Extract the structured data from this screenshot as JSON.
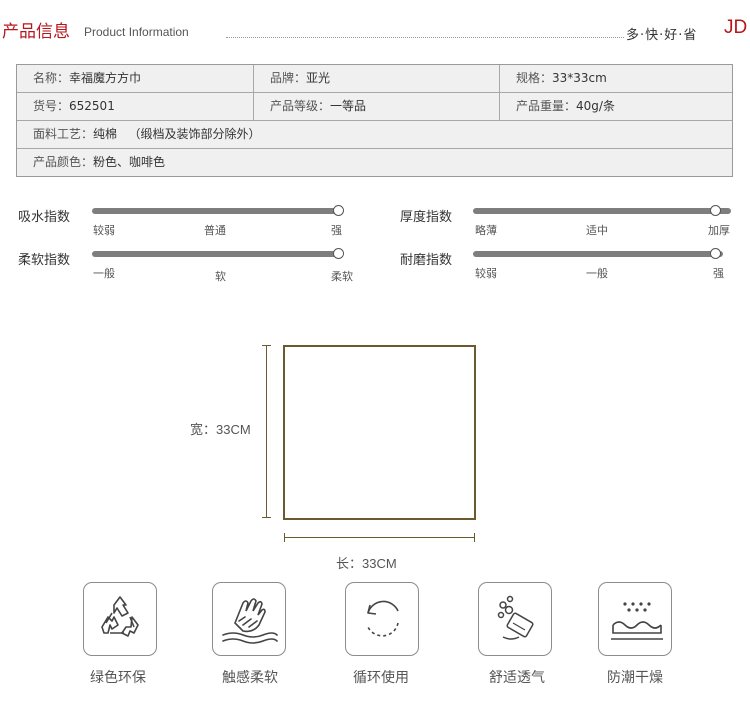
{
  "header": {
    "title": "产品信息",
    "subtitle": "Product Information",
    "slogan": "多·快·好·省",
    "logo": "JD",
    "accent": "#b8151c"
  },
  "specs": {
    "rows": [
      [
        {
          "label": "名称：",
          "value": "幸福魔方方巾"
        },
        {
          "label": "品牌：",
          "value": "亚光"
        },
        {
          "label": "规格：",
          "value": "33*33cm"
        }
      ],
      [
        {
          "label": "货号：",
          "value": "652501"
        },
        {
          "label": "产品等级：",
          "value": "一等品"
        },
        {
          "label": "产品重量：",
          "value": "40g/条"
        }
      ],
      [
        {
          "label": "面料工艺：",
          "value": "纯棉   （缎档及装饰部分除外）"
        }
      ],
      [
        {
          "label": "产品颜色：",
          "value": "粉色、咖啡色"
        }
      ]
    ]
  },
  "indices": [
    {
      "name": "吸水指数",
      "ticks": [
        "较弱",
        "普通",
        "强"
      ],
      "level": 1.0
    },
    {
      "name": "厚度指数",
      "ticks": [
        "略薄",
        "适中",
        "加厚"
      ],
      "level": 1.0
    },
    {
      "name": "柔软指数",
      "ticks": [
        "一般",
        "软",
        "柔软"
      ],
      "level": 1.0
    },
    {
      "name": "耐磨指数",
      "ticks": [
        "较弱",
        "一般",
        "强"
      ],
      "level": 1.0
    }
  ],
  "dimensions": {
    "width_label": "宽：33CM",
    "length_label": "长：33CM"
  },
  "features": [
    {
      "icon": "recycle-icon",
      "label": "绿色环保"
    },
    {
      "icon": "hand-touch-icon",
      "label": "触感柔软"
    },
    {
      "icon": "cycle-arrow-icon",
      "label": "循环使用"
    },
    {
      "icon": "bubbles-icon",
      "label": "舒适透气"
    },
    {
      "icon": "moisture-icon",
      "label": "防潮干燥"
    }
  ]
}
